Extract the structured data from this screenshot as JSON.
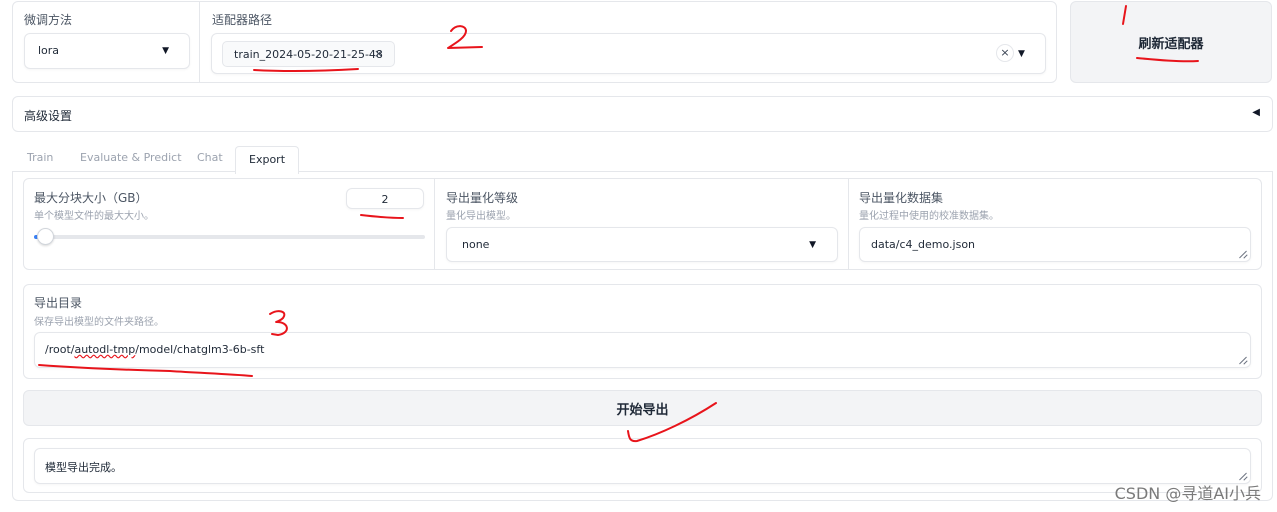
{
  "adapter_row": {
    "method_label": "微调方法",
    "method_value": "lora",
    "path_label": "适配器路径",
    "path_tag": "train_2024-05-20-21-25-48",
    "path_tag_remove": "×",
    "clear_symbol": "×",
    "refresh_button": "刷新适配器"
  },
  "advanced": {
    "label": "高级设置",
    "toggle_symbol": "◀"
  },
  "tabs": [
    {
      "label": "Train"
    },
    {
      "label": "Evaluate & Predict"
    },
    {
      "label": "Chat"
    },
    {
      "label": "Export"
    }
  ],
  "active_tab": "Export",
  "export": {
    "shard_size": {
      "label": "最大分块大小（GB）",
      "info": "单个模型文件的最大大小。",
      "value": "2",
      "slider_fraction": 0.0
    },
    "quant_bit": {
      "label": "导出量化等级",
      "info": "量化导出模型。",
      "value": "none"
    },
    "quant_dataset": {
      "label": "导出量化数据集",
      "info": "量化过程中使用的校准数据集。",
      "value": "data/c4_demo.json"
    },
    "export_dir": {
      "label": "导出目录",
      "info": "保存导出模型的文件夹路径。",
      "value": "/root/autodl-tmp/model/chatglm3-6b-sft"
    },
    "start_button": "开始导出",
    "output": "模型导出完成。"
  },
  "annotations": [
    "1",
    "2",
    "3"
  ],
  "watermark": "CSDN @寻道AI小兵",
  "colors": {
    "annotation_red": "#e8141b",
    "button_bg": "#f3f4f6",
    "border": "#e5e7eb"
  }
}
